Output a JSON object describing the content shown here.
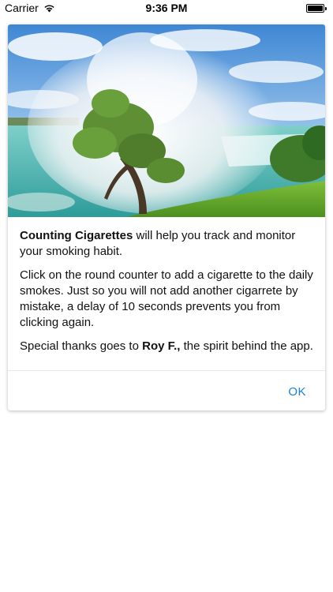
{
  "status_bar": {
    "carrier": "Carrier",
    "time": "9:36 PM",
    "wifi_icon": "wifi-icon",
    "battery_icon": "battery-icon"
  },
  "dialog": {
    "hero_image": "waterfall-with-tree-image",
    "paragraph1": {
      "bold": "Counting Cigarettes",
      "rest": " will help you track and monitor your smoking habit."
    },
    "paragraph2": "Click on the round counter to add a cigarette to the daily smokes. Just so you will not add another cigarrete by mistake, a delay of 10 seconds prevents you from clicking again.",
    "paragraph3": {
      "before": "Special thanks goes to ",
      "bold": "Roy F.,",
      "after": " the spirit behind the app."
    },
    "ok_label": "OK",
    "accent_color": "#1a7fd0"
  }
}
